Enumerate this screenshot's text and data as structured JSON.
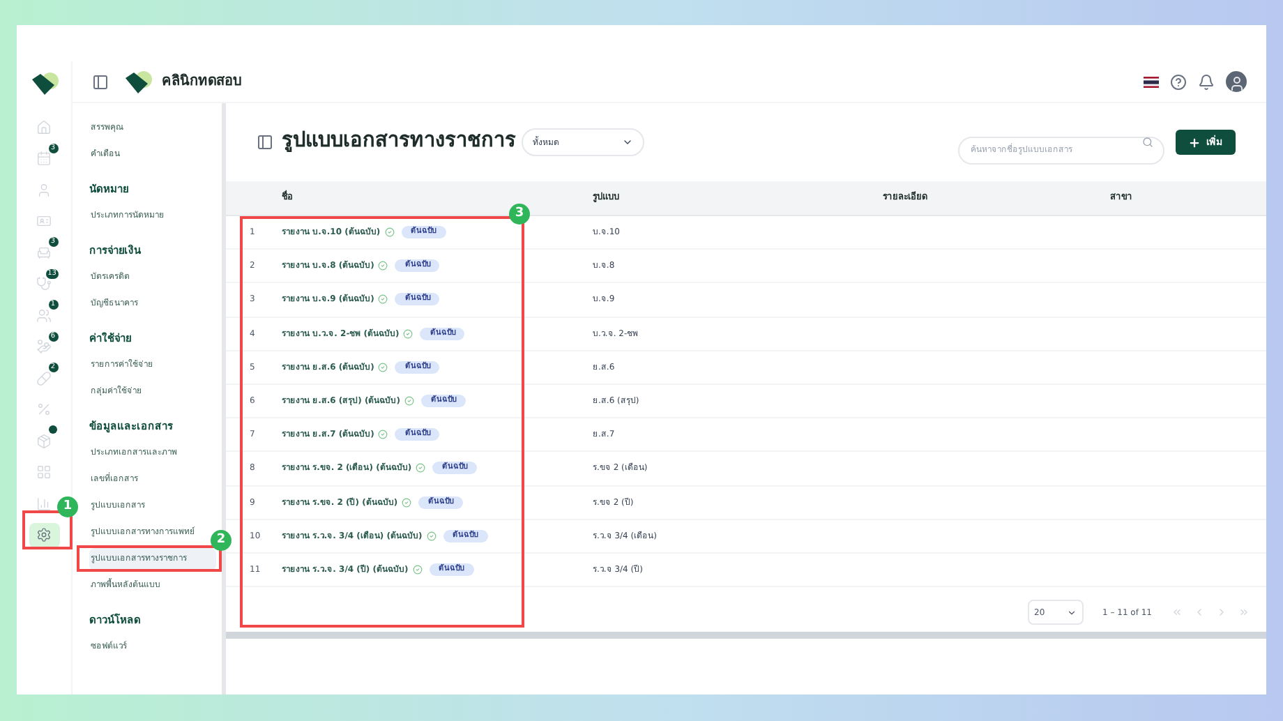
{
  "header": {
    "clinic_name": "คลินิกทดสอบ"
  },
  "rail": [
    {
      "kind": "home",
      "selected": false
    },
    {
      "kind": "calendar",
      "badge": "3",
      "selected": false
    },
    {
      "kind": "user",
      "selected": false
    },
    {
      "kind": "card",
      "selected": false
    },
    {
      "kind": "armchair",
      "badge": "3",
      "selected": false
    },
    {
      "kind": "stethoscope",
      "badge": "13",
      "selected": false
    },
    {
      "kind": "users",
      "badge": "1",
      "selected": false
    },
    {
      "kind": "hand",
      "badge": "6",
      "selected": false
    },
    {
      "kind": "pill",
      "badge": "2",
      "selected": false
    },
    {
      "kind": "percent",
      "selected": false
    },
    {
      "kind": "package",
      "dot": true,
      "selected": false
    },
    {
      "kind": "grid",
      "selected": false
    },
    {
      "kind": "chart",
      "selected": false
    },
    {
      "kind": "settings",
      "selected": true
    }
  ],
  "sidebar": [
    {
      "kind": "item",
      "label": "สรรพคุณ",
      "selected": false
    },
    {
      "kind": "item",
      "label": "คำเตือน",
      "selected": false
    },
    {
      "kind": "heading",
      "label": "นัดหมาย"
    },
    {
      "kind": "item",
      "label": "ประเภทการนัดหมาย",
      "selected": false
    },
    {
      "kind": "heading",
      "label": "การจ่ายเงิน"
    },
    {
      "kind": "item",
      "label": "บัตรเครดิต",
      "selected": false
    },
    {
      "kind": "item",
      "label": "บัญชีธนาคาร",
      "selected": false
    },
    {
      "kind": "heading",
      "label": "ค่าใช้จ่าย"
    },
    {
      "kind": "item",
      "label": "รายการค่าใช้จ่าย",
      "selected": false
    },
    {
      "kind": "item",
      "label": "กลุ่มค่าใช้จ่าย",
      "selected": false
    },
    {
      "kind": "heading",
      "label": "ข้อมูลและเอกสาร"
    },
    {
      "kind": "item",
      "label": "ประเภทเอกสารและภาพ",
      "selected": false
    },
    {
      "kind": "item",
      "label": "เลขที่เอกสาร",
      "selected": false
    },
    {
      "kind": "item",
      "label": "รูปแบบเอกสาร",
      "selected": false
    },
    {
      "kind": "item",
      "label": "รูปแบบเอกสารทางการแพทย์",
      "selected": false
    },
    {
      "kind": "item",
      "label": "รูปแบบเอกสารทางราชการ",
      "selected": true
    },
    {
      "kind": "item",
      "label": "ภาพพื้นหลังต้นแบบ",
      "selected": false
    },
    {
      "kind": "heading",
      "label": "ดาวน์โหลด"
    },
    {
      "kind": "item",
      "label": "ซอฟต์แวร์",
      "selected": false
    }
  ],
  "page": {
    "title": "รูปแบบเอกสารทางราชการ",
    "filter": "ทั้งหมด",
    "search": {
      "placeholder": "ค้นหาจากชื่อรูปแบบเอกสาร"
    },
    "add_button": "เพิ่ม"
  },
  "table": {
    "columns": [
      "ชื่อ",
      "รูปแบบ",
      "รายละเอียด",
      "สาขา"
    ],
    "rows": [
      {
        "no": "1",
        "name": "รายงาน บ.จ.10 (ต้นฉบับ)",
        "badge": "ต้นฉบับ",
        "format": "บ.จ.10"
      },
      {
        "no": "2",
        "name": "รายงาน บ.จ.8 (ต้นฉบับ)",
        "badge": "ต้นฉบับ",
        "format": "บ.จ.8"
      },
      {
        "no": "3",
        "name": "รายงาน บ.จ.9 (ต้นฉบับ)",
        "badge": "ต้นฉบับ",
        "format": "บ.จ.9"
      },
      {
        "no": "4",
        "name": "รายงาน บ.ว.จ. 2-ชพ (ต้นฉบับ)",
        "badge": "ต้นฉบับ",
        "format": "บ.ว.จ. 2-ชพ"
      },
      {
        "no": "5",
        "name": "รายงาน ย.ส.6 (ต้นฉบับ)",
        "badge": "ต้นฉบับ",
        "format": "ย.ส.6"
      },
      {
        "no": "6",
        "name": "รายงาน ย.ส.6 (สรุป) (ต้นฉบับ)",
        "badge": "ต้นฉบับ",
        "format": "ย.ส.6 (สรุป)"
      },
      {
        "no": "7",
        "name": "รายงาน ย.ส.7 (ต้นฉบับ)",
        "badge": "ต้นฉบับ",
        "format": "ย.ส.7"
      },
      {
        "no": "8",
        "name": "รายงาน ร.ขจ. 2 (เดือน) (ต้นฉบับ)",
        "badge": "ต้นฉบับ",
        "format": "ร.ขจ 2 (เดือน)"
      },
      {
        "no": "9",
        "name": "รายงาน ร.ขจ. 2 (ปี) (ต้นฉบับ)",
        "badge": "ต้นฉบับ",
        "format": "ร.ขจ 2 (ปี)"
      },
      {
        "no": "10",
        "name": "รายงาน ร.ว.จ. 3/4 (เดือน) (ต้นฉบับ)",
        "badge": "ต้นฉบับ",
        "format": "ร.ว.จ 3/4 (เดือน)"
      },
      {
        "no": "11",
        "name": "รายงาน ร.ว.จ. 3/4 (ปี) (ต้นฉบับ)",
        "badge": "ต้นฉบับ",
        "format": "ร.ว.จ 3/4 (ปี)"
      }
    ]
  },
  "pagination": {
    "page_size": "20",
    "range": "1 – 11 of 11"
  },
  "annotations": [
    {
      "number": "1"
    },
    {
      "number": "2"
    },
    {
      "number": "3"
    }
  ]
}
